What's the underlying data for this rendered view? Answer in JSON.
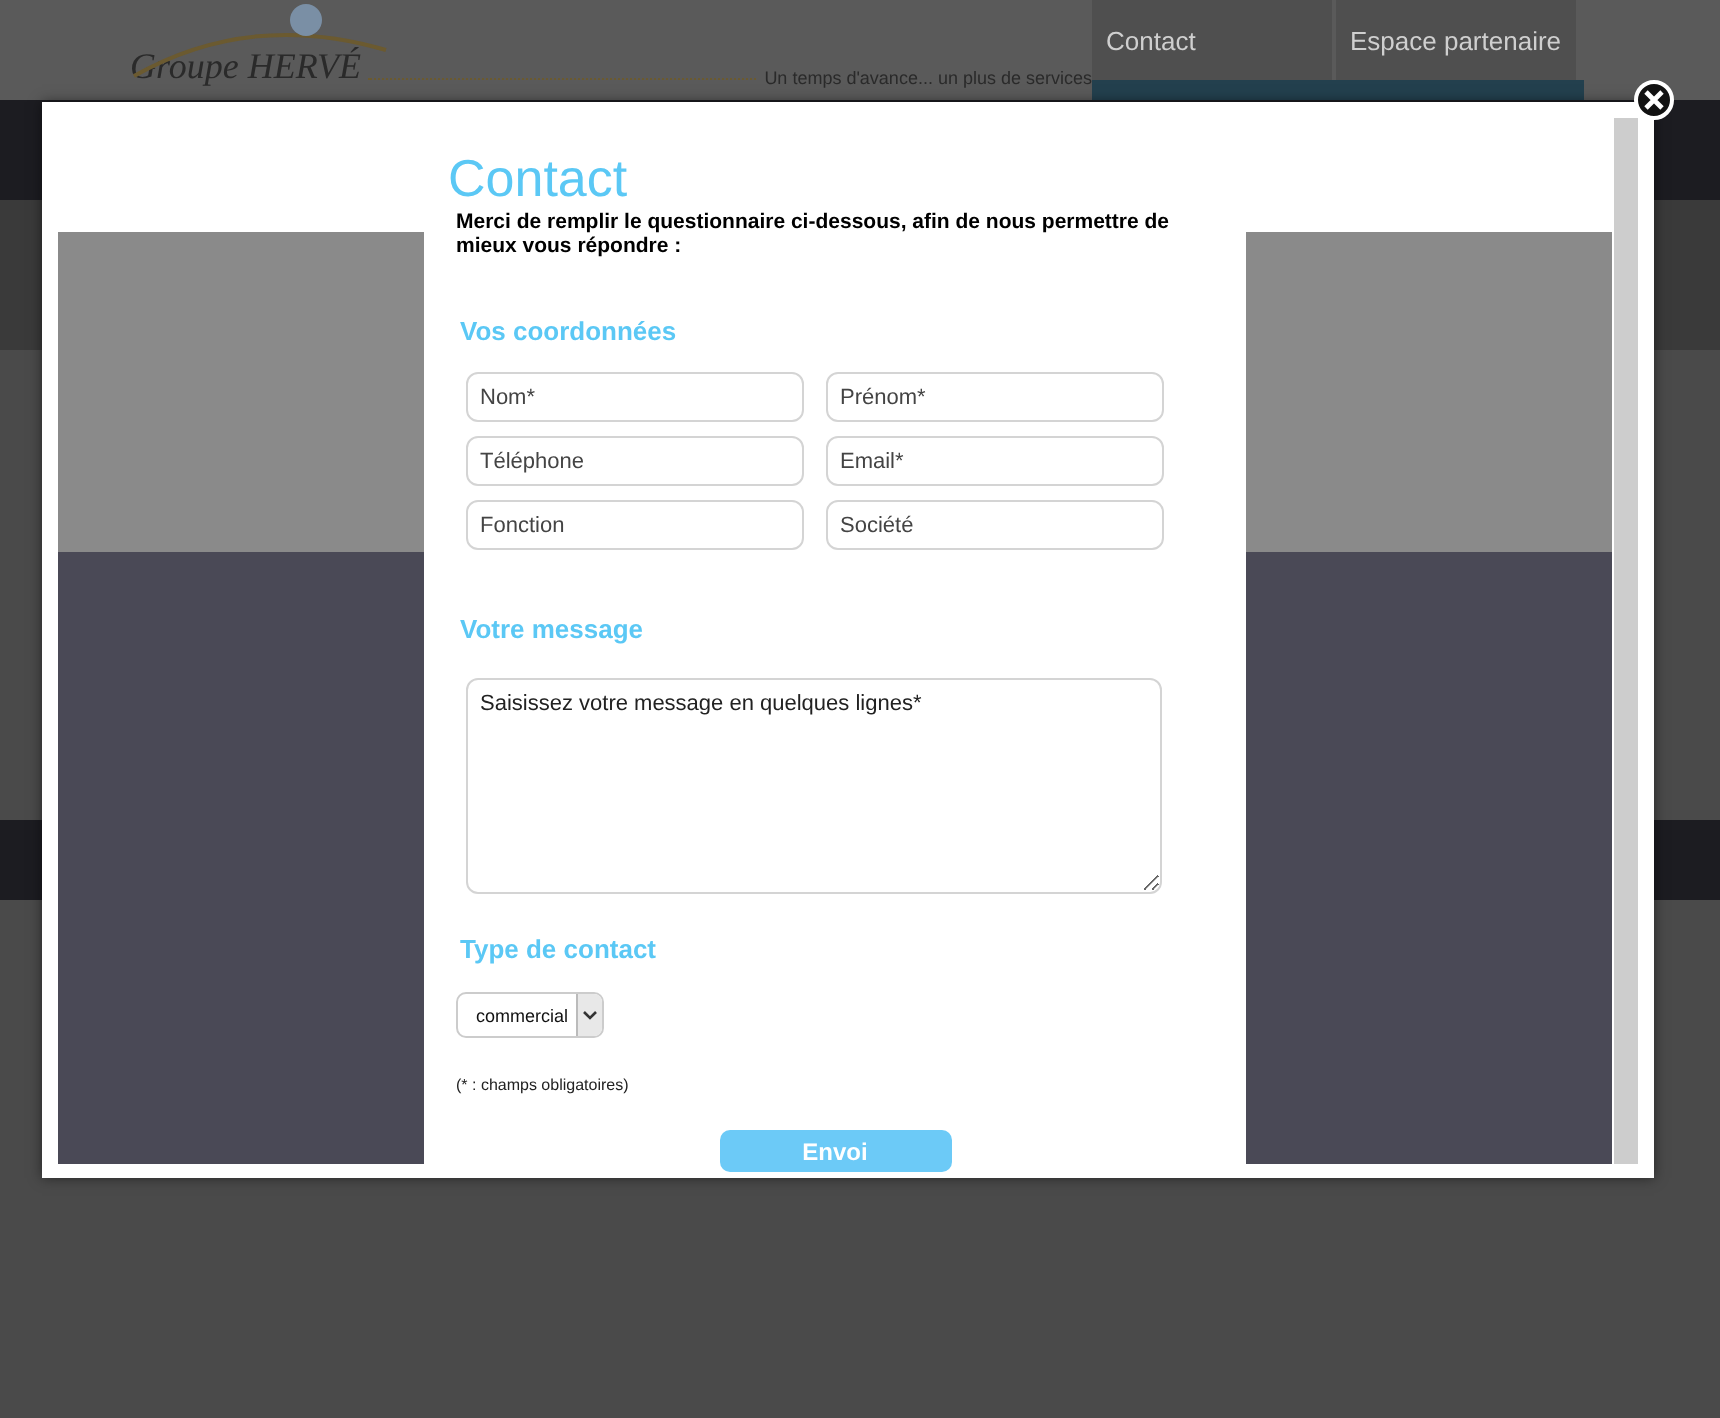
{
  "header": {
    "logo_text": "Groupe HERVÉ",
    "tagline": "Un temps d'avance... un plus de services",
    "nav": [
      {
        "label": "Contact"
      },
      {
        "label": "Espace partenaire"
      }
    ]
  },
  "modal": {
    "title": "Contact",
    "intro": "Merci de remplir le questionnaire ci-dessous, afin de nous permettre de mieux vous répondre :",
    "sections": [
      {
        "heading": "Vos coordonnées",
        "fields": [
          {
            "placeholder": "Nom*"
          },
          {
            "placeholder": "Prénom*"
          },
          {
            "placeholder": "Téléphone"
          },
          {
            "placeholder": "Email*"
          },
          {
            "placeholder": "Fonction"
          },
          {
            "placeholder": "Société"
          }
        ]
      },
      {
        "heading": "Votre message",
        "message_placeholder": "Saisissez votre message en quelques lignes*"
      },
      {
        "heading": "Type de contact",
        "select_value": "commercial"
      }
    ],
    "note": "(* : champs obligatoires)",
    "submit": "Envoi"
  }
}
